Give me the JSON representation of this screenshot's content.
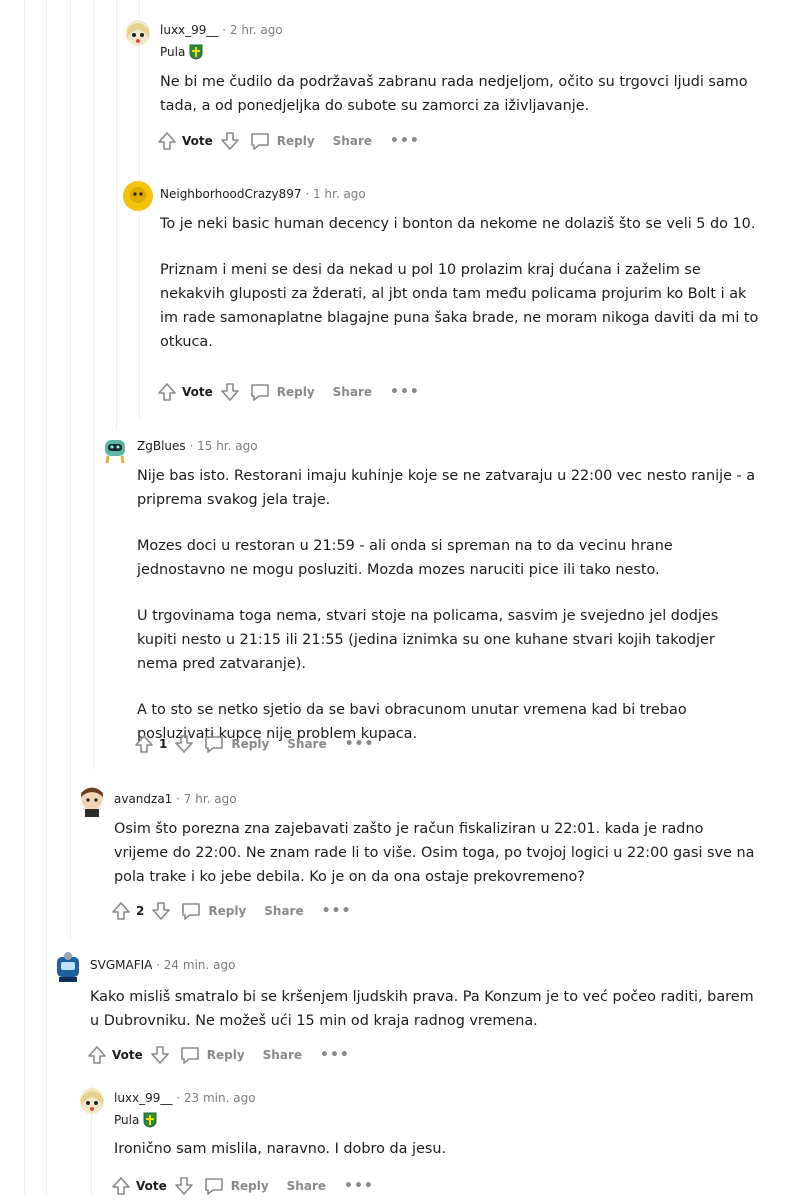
{
  "action_labels": {
    "vote": "Vote",
    "reply": "Reply",
    "share": "Share",
    "more": "•••"
  },
  "colors": {
    "meta": "#7c7c7c",
    "action": "#878a8c",
    "text": "#1c1c1c",
    "thread_line": "#edeff1",
    "flair_shield": "#2b8a3e"
  },
  "comments": [
    {
      "author": "luxx_99__",
      "time": "· 2 hr. ago",
      "flair": "Pula",
      "paragraphs": [
        "Ne bi me čudilo da podržavaš zabranu rada nedjeljom, očito su trgovci ljudi samo tada, a od ponedjeljka do subote su zamorci za iživljavanje."
      ],
      "score": "Vote"
    },
    {
      "author": "NeighborhoodCrazy897",
      "time": "· 1 hr. ago",
      "paragraphs": [
        "To je neki basic human decency i bonton da nekome ne dolaziš što se veli 5 do 10.",
        "Priznam i meni se desi da nekad u pol 10 prolazim kraj dućana i zaželim se nekakvih gluposti za žderati, al jbt onda tam među policama projurim ko Bolt i ak im rade samonaplatne blagajne puna šaka brade, ne moram nikoga daviti da mi to otkuca."
      ],
      "score": "Vote"
    },
    {
      "author": "ZgBlues",
      "time": "· 15 hr. ago",
      "paragraphs": [
        "Nije bas isto. Restorani imaju kuhinje koje se ne zatvaraju u 22:00 vec nesto ranije - a priprema svakog jela traje.",
        "Mozes doci u restoran u 21:59 - ali onda si spreman na to da vecinu hrane jednostavno ne mogu posluziti. Mozda mozes naruciti pice ili tako nesto.",
        "U trgovinama toga nema, stvari stoje na policama, sasvim je svejedno jel dodjes kupiti nesto u 21:15 ili 21:55 (jedina iznimka su one kuhane stvari kojih takodjer nema pred zatvaranje).",
        "A to sto se netko sjetio da se bavi obracunom unutar vremena kad bi trebao posluzivati kupce nije problem kupaca."
      ],
      "score": "1"
    },
    {
      "author": "avandza1",
      "time": "· 7 hr. ago",
      "paragraphs": [
        "Osim što porezna zna zajebavati zašto je račun fiskaliziran u 22:01. kada je radno vrijeme do 22:00. Ne znam rade li to više. Osim toga, po tvojoj logici u 22:00 gasi sve na pola trake i ko jebe debila. Ko je on da ona ostaje prekovremeno?"
      ],
      "score": "2"
    },
    {
      "author": "SVGMAFIA",
      "time": "· 24 min. ago",
      "paragraphs": [
        "Kako misliš smatralo bi se kršenjem ljudskih prava. Pa Konzum je to već počeo raditi, barem u Dubrovniku. Ne možeš ući 15 min od kraja radnog vremena."
      ],
      "score": "Vote"
    },
    {
      "author": "luxx_99__",
      "time": "· 23 min. ago",
      "flair": "Pula",
      "paragraphs": [
        "Ironično sam mislila, naravno. I dobro da jesu."
      ],
      "score": "Vote"
    }
  ]
}
